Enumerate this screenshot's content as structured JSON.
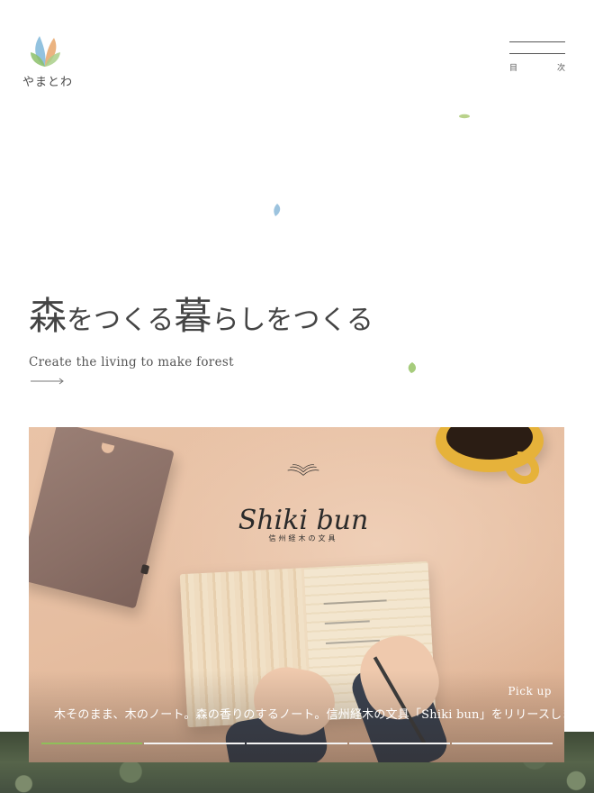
{
  "header": {
    "logo_text": "やまとわ",
    "menu_label_left": "目",
    "menu_label_right": "次"
  },
  "hero": {
    "tagline_parts": [
      "森",
      "をつくる",
      "暮",
      "らしをつくる"
    ],
    "subtitle": "Create the living to make forest"
  },
  "feature": {
    "brand_name": "Shiki bun",
    "brand_sub": "信州経木の文具",
    "pick_label": "Pick up",
    "caption": "木そのまま、木のノート。森の香りのするノート。信州経木の文具「Shiki bun」をリリースしました",
    "slides_total": 5,
    "active_slide": 1
  },
  "colors": {
    "accent_green": "#8fbf5a",
    "text": "#444444",
    "logo_blue": "#7fb7d9",
    "logo_orange": "#e8a66a",
    "logo_green": "#8cbf6a"
  }
}
